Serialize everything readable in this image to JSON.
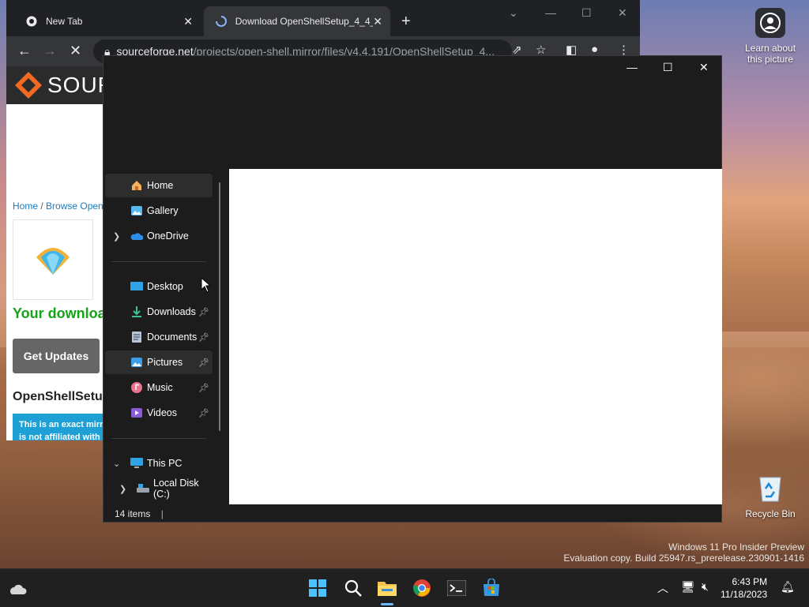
{
  "desktop": {
    "learn_about": "Learn about this picture",
    "recycle_bin": "Recycle Bin",
    "watermark_line1": "Windows 11 Pro Insider Preview",
    "watermark_line2": "Evaluation copy. Build 25947.rs_prerelease.230901-1416"
  },
  "browser": {
    "tabs": [
      {
        "title": "New Tab",
        "icon": "chrome-icon"
      },
      {
        "title": "Download OpenShellSetup_4_4_",
        "icon": "loading-icon"
      }
    ],
    "url_host": "sourceforge.net",
    "url_path": "/projects/open-shell.mirror/files/v4.4.191/OpenShellSetup_4...",
    "page": {
      "logo_text": "SOURC",
      "breadcrumb_home": "Home",
      "breadcrumb_sep": " / ",
      "breadcrumb_browse": "Browse Open",
      "download_msg": "Your downloa",
      "get_updates": "Get Updates",
      "file_title": "OpenShellSetup",
      "mirror_line1": "This is an exact mirr",
      "mirror_line2": "is not affiliated with"
    }
  },
  "explorer": {
    "nav": [
      {
        "label": "Home",
        "icon": "home-icon",
        "selected": true
      },
      {
        "label": "Gallery",
        "icon": "gallery-icon"
      },
      {
        "label": "OneDrive",
        "icon": "onedrive-icon",
        "expandable": true
      },
      {
        "label": "Desktop",
        "icon": "desktop-folder-icon"
      },
      {
        "label": "Downloads",
        "icon": "downloads-folder-icon",
        "pinned": true
      },
      {
        "label": "Documents",
        "icon": "documents-folder-icon",
        "pinned": true
      },
      {
        "label": "Pictures",
        "icon": "pictures-folder-icon",
        "pinned": true,
        "selected": true
      },
      {
        "label": "Music",
        "icon": "music-folder-icon",
        "pinned": true
      },
      {
        "label": "Videos",
        "icon": "videos-folder-icon",
        "pinned": true
      },
      {
        "label": "This PC",
        "icon": "this-pc-icon",
        "expanded": true
      },
      {
        "label": "Local Disk (C:)",
        "icon": "drive-icon",
        "expandable": true
      }
    ],
    "status": "14 items"
  },
  "taskbar": {
    "time": "6:43 PM",
    "date": "11/18/2023"
  },
  "colors": {
    "accent": "#0078d4",
    "download_green": "#15a415",
    "link_blue": "#1e7ab8",
    "mirror_blue": "#1ea0d6"
  }
}
